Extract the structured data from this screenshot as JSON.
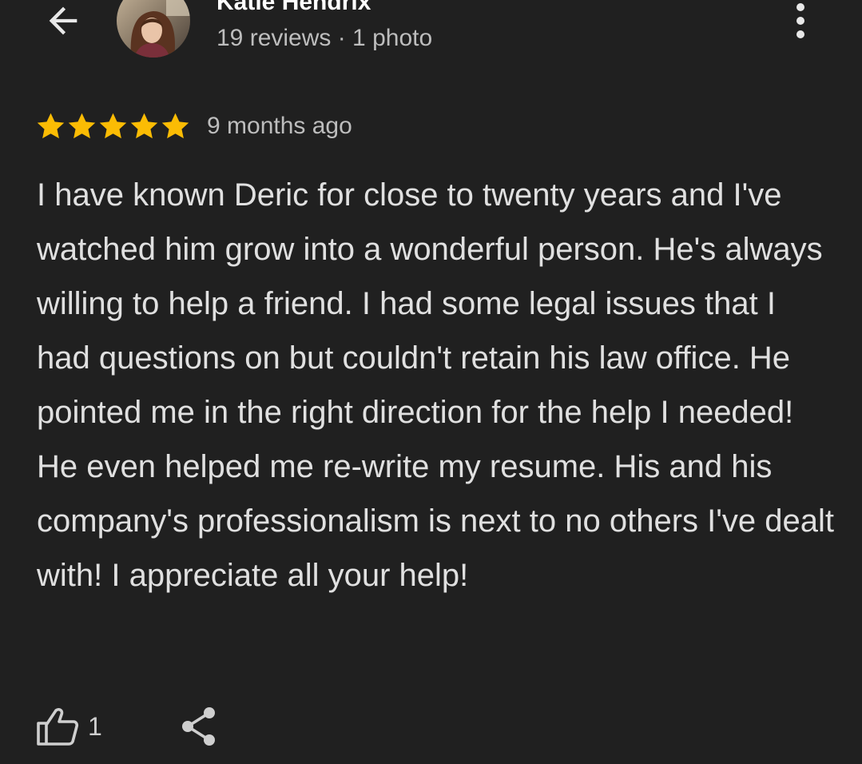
{
  "reviewer": {
    "name": "Katie Hendrix",
    "meta": "19 reviews · 1 photo"
  },
  "review": {
    "rating": 5,
    "max_rating": 5,
    "date": "9 months ago",
    "paragraphs": [
      "I have known Deric for close to twenty years and I've watched him grow into a wonderful person. He's always willing to help a friend. I had some legal issues that I had questions on but couldn't retain his law office. He pointed me in the right direction for the help I needed!",
      "He even helped me re-write my resume. His and his company's professionalism is next to no others I've dealt with! I appreciate all your help!"
    ]
  },
  "actions": {
    "like_count": "1"
  },
  "icons": {
    "back": "arrow-back-icon",
    "more": "more-vert-icon",
    "star": "star-icon",
    "like": "thumb-up-icon",
    "share": "share-icon"
  },
  "colors": {
    "background": "#202020",
    "star": "#fbbc04",
    "text": "#e0e0e0",
    "secondary_text": "#bdbdbd"
  }
}
